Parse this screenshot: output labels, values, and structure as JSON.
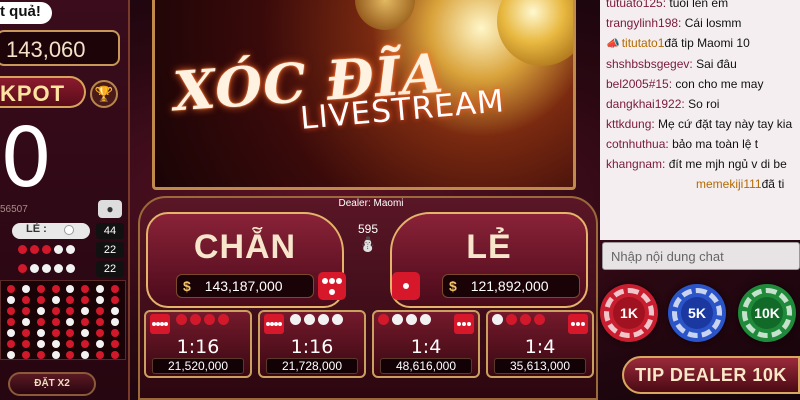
{
  "left": {
    "result_tag": "t quả!",
    "balance": "143,060",
    "jackpot_label": "KPOT",
    "jackpot_digit": "0",
    "session_id": "56507",
    "le_label": "LẺ :",
    "stat_row1": "44",
    "stat_row2": "22",
    "stat_row3": "22",
    "dat_x2": "ĐẶT X2"
  },
  "video": {
    "title": "XÓC ĐĨA",
    "subtitle": "LIVESTREAM"
  },
  "table": {
    "dealer": "Dealer: Maomi",
    "player_count": "595",
    "chan": {
      "label": "CHẴN",
      "total": "143,187,000"
    },
    "le": {
      "label": "LẺ",
      "total": "121,892,000"
    },
    "currency": "$",
    "small_bets": [
      {
        "odds": "1:16",
        "amount": "21,520,000"
      },
      {
        "odds": "1:16",
        "amount": "21,728,000"
      },
      {
        "odds": "1:4",
        "amount": "48,616,000"
      },
      {
        "odds": "1:4",
        "amount": "35,613,000"
      }
    ]
  },
  "chat": {
    "messages": [
      {
        "user": "tutuato125:",
        "text": "tuoi len em"
      },
      {
        "user": "trangylinh198:",
        "text": "Cái losmm"
      },
      {
        "user": "titutato1",
        "text": "đã tip Maomi 10",
        "tip": true
      },
      {
        "user": "shshbsbsgegev:",
        "text": "Sai đâu"
      },
      {
        "user": "bel2005#15:",
        "text": "con cho me may"
      },
      {
        "user": "dangkhai1922:",
        "text": "So roi"
      },
      {
        "user": "kttkdung:",
        "text": "Mẹ cứ đặt tay này tay kia"
      },
      {
        "user": "cotnhuthua:",
        "text": "bảo ma toàn lệ t"
      },
      {
        "user": "khangnam:",
        "text": "đít me mjh ngủ v di be"
      },
      {
        "user": "memekiji111",
        "text": "đã ti",
        "tip": true
      }
    ],
    "input_placeholder": "Nhập nội dung chat"
  },
  "chips": {
    "c1": "1K",
    "c2": "5K",
    "c3": "10K"
  },
  "tip_button": "TIP DEALER 10K",
  "colors": {
    "accent_gold": "#d8a860",
    "chip_red": "#c81e30",
    "chip_blue": "#2a54c8",
    "chip_green": "#1e8a3a",
    "dice_red": "#d7172a"
  }
}
